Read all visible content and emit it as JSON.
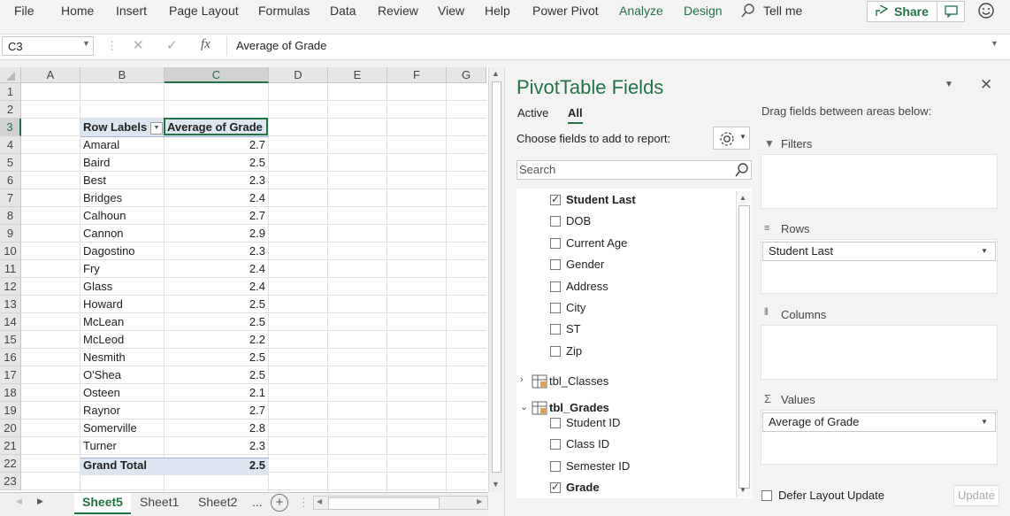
{
  "ribbon": {
    "tabs": [
      "File",
      "Home",
      "Insert",
      "Page Layout",
      "Formulas",
      "Data",
      "Review",
      "View",
      "Help",
      "Power Pivot",
      "Analyze",
      "Design"
    ],
    "tell_me": "Tell me",
    "share": "Share"
  },
  "formula_bar": {
    "name_box": "C3",
    "formula": "Average of Grade",
    "fx": "fx"
  },
  "grid": {
    "columns": [
      "A",
      "B",
      "C",
      "D",
      "E",
      "F",
      "G"
    ],
    "rows": [
      "1",
      "2",
      "3",
      "4",
      "5",
      "6",
      "7",
      "8",
      "9",
      "10",
      "11",
      "12",
      "13",
      "14",
      "15",
      "16",
      "17",
      "18",
      "19",
      "20",
      "21",
      "22",
      "23"
    ],
    "header_row_label": "Row Labels",
    "header_value_label": "Average of Grade",
    "data": [
      {
        "name": "Amaral",
        "value": "2.7"
      },
      {
        "name": "Baird",
        "value": "2.5"
      },
      {
        "name": "Best",
        "value": "2.3"
      },
      {
        "name": "Bridges",
        "value": "2.4"
      },
      {
        "name": "Calhoun",
        "value": "2.7"
      },
      {
        "name": "Cannon",
        "value": "2.9"
      },
      {
        "name": "Dagostino",
        "value": "2.3"
      },
      {
        "name": "Fry",
        "value": "2.4"
      },
      {
        "name": "Glass",
        "value": "2.4"
      },
      {
        "name": "Howard",
        "value": "2.5"
      },
      {
        "name": "McLean",
        "value": "2.5"
      },
      {
        "name": "McLeod",
        "value": "2.2"
      },
      {
        "name": "Nesmith",
        "value": "2.5"
      },
      {
        "name": "O'Shea",
        "value": "2.5"
      },
      {
        "name": "Osteen",
        "value": "2.1"
      },
      {
        "name": "Raynor",
        "value": "2.7"
      },
      {
        "name": "Somerville",
        "value": "2.8"
      },
      {
        "name": "Turner",
        "value": "2.3"
      }
    ],
    "grand_total_label": "Grand Total",
    "grand_total_value": "2.5"
  },
  "sheet_tabs": [
    "Sheet5",
    "Sheet1",
    "Sheet2"
  ],
  "sheet_tabs_more": "...",
  "pivot": {
    "title": "PivotTable Fields",
    "tab_active": "Active",
    "tab_all": "All",
    "choose_label": "Choose fields to add to report:",
    "search_placeholder": "Search",
    "fields": [
      {
        "label": "Student Last",
        "checked": true
      },
      {
        "label": "DOB",
        "checked": false
      },
      {
        "label": "Current Age",
        "checked": false
      },
      {
        "label": "Gender",
        "checked": false
      },
      {
        "label": "Address",
        "checked": false
      },
      {
        "label": "City",
        "checked": false
      },
      {
        "label": "ST",
        "checked": false
      },
      {
        "label": "Zip",
        "checked": false
      }
    ],
    "table_classes": "tbl_Classes",
    "table_grades": "tbl_Grades",
    "grade_fields": [
      {
        "label": "Student ID",
        "checked": false
      },
      {
        "label": "Class ID",
        "checked": false
      },
      {
        "label": "Semester ID",
        "checked": false
      },
      {
        "label": "Grade",
        "checked": true
      }
    ],
    "drag_label": "Drag fields between areas below:",
    "filters_label": "Filters",
    "rows_label": "Rows",
    "rows_value": "Student Last",
    "columns_label": "Columns",
    "values_label": "Values",
    "values_value": "Average of Grade",
    "defer_label": "Defer Layout Update",
    "update_label": "Update"
  },
  "colors": {
    "accent_green": "#217346",
    "header_fill": "#dce6f1"
  }
}
